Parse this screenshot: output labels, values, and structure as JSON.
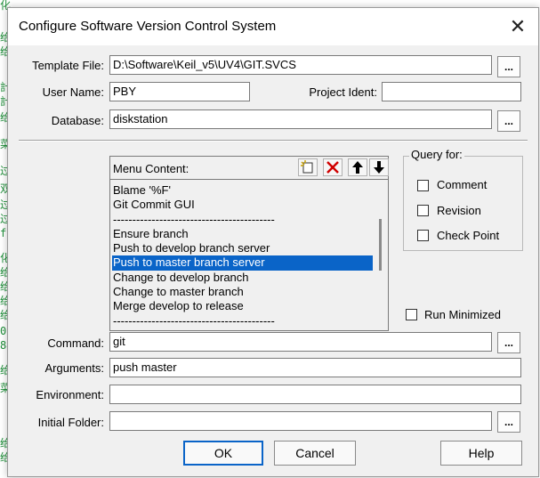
{
  "background_glyphs": [
    "化A&C2過短",
    "给",
    "给",
    "計",
    "計",
    "给",
    "菜",
    "过",
    "双",
    "过",
    "过",
    "f",
    "化",
    "给",
    "给",
    "给",
    "给",
    "06",
    "84",
    "给",
    "菜",
    "给",
    "给"
  ],
  "dialog": {
    "title": "Configure Software Version Control System",
    "close_symbol": "✕",
    "ok_label": "OK",
    "cancel_label": "Cancel",
    "help_label": "Help"
  },
  "fields": {
    "template_file": {
      "label": "Template File:",
      "value": "D:\\Software\\Keil_v5\\UV4\\GIT.SVCS"
    },
    "user_name": {
      "label": "User Name:",
      "value": "PBY"
    },
    "project_ident": {
      "label": "Project Ident:",
      "value": ""
    },
    "database": {
      "label": "Database:",
      "value": "diskstation"
    },
    "command": {
      "label": "Command:",
      "value": "git"
    },
    "arguments": {
      "label": "Arguments:",
      "value": "push master"
    },
    "environment": {
      "label": "Environment:",
      "value": ""
    },
    "initial_folder": {
      "label": "Initial Folder:",
      "value": ""
    },
    "browse_label": "..."
  },
  "menu": {
    "label": "Menu Content:",
    "items": [
      "Blame '%F'",
      "Git Commit GUI",
      "------------------------------------------",
      "Ensure branch",
      "Push to develop branch server",
      "Push to master branch server",
      "Change to develop branch",
      "Change to master branch",
      "Merge develop to release",
      "------------------------------------------"
    ],
    "selected_index": 5
  },
  "query": {
    "label": "Query for:",
    "comment": "Comment",
    "revision": "Revision",
    "check_point": "Check Point"
  },
  "run_minimized": "Run Minimized",
  "colors": {
    "selection": "#0a64c8",
    "delete_icon": "#d00000",
    "default_button_border": "#0a64c8"
  }
}
